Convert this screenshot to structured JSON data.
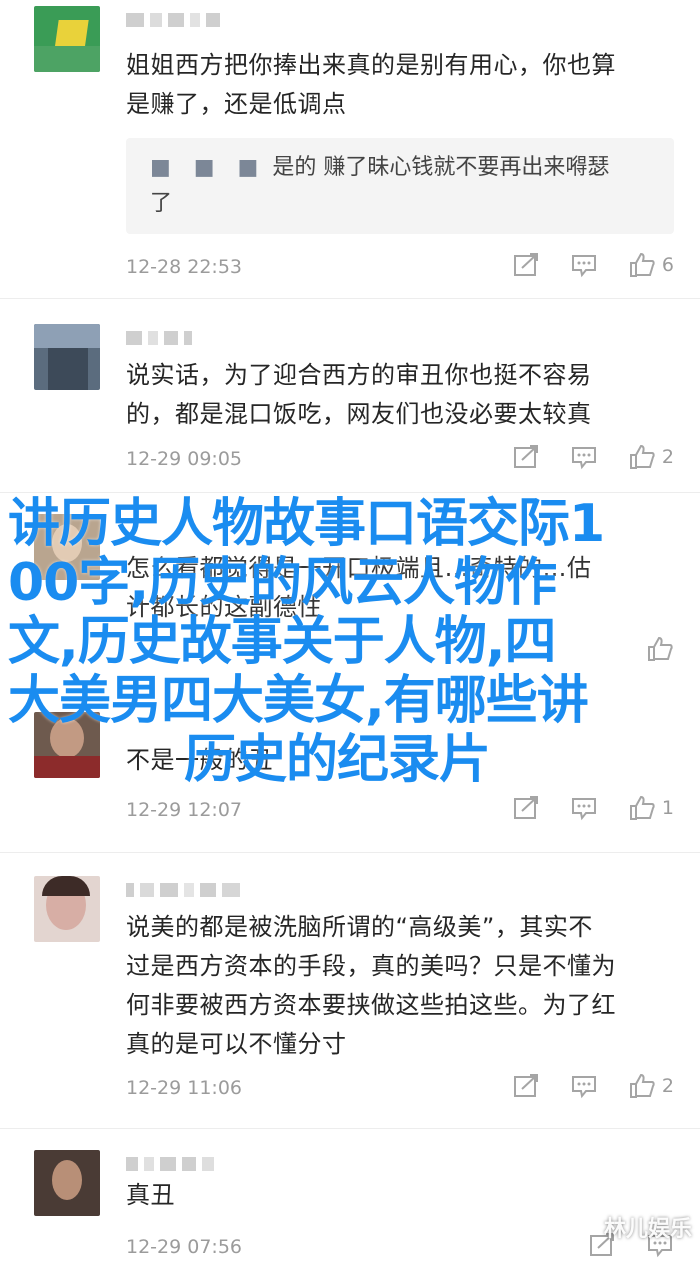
{
  "comments": [
    {
      "text_lines": [
        "姐姐西方把你捧出来真的是别有用心，你也算",
        "是赚了，还是低调点"
      ],
      "quote": {
        "dots": "■ ■ ■",
        "lines": [
          "是的 赚了昧心钱就不要再出来嘚瑟",
          "了"
        ]
      },
      "time": "12-28 22:53",
      "likes": "6"
    },
    {
      "text_lines": [
        "说实话，为了迎合西方的审丑你也挺不容易",
        "的，都是混口饭吃，网友们也没必要太较真"
      ],
      "time": "12-29 09:05",
      "likes": "2"
    },
    {
      "text_lines": [
        "怎么看都觉得是一开口极端且…奇特的…估",
        "计都长的这副德性"
      ],
      "time": "",
      "likes": ""
    },
    {
      "text_lines": [
        "不是一般的丑"
      ],
      "time": "12-29 12:07",
      "likes": "1"
    },
    {
      "text_lines": [
        "说美的都是被洗脑所谓的“高级美”，其实不",
        "过是西方资本的手段，真的美吗？只是不懂为",
        "何非要被西方资本要挟做这些拍这些。为了红",
        "真的是可以不懂分寸"
      ],
      "time": "12-29 11:06",
      "likes": "2"
    },
    {
      "text_lines": [
        "真丑"
      ],
      "time": "12-29 07:56",
      "likes": ""
    }
  ],
  "overlay_lines": [
    "讲历史人物故事口语交际1",
    "00字,历史的风云人物作",
    "文,历史故事关于人物,四",
    "大美男四大美女,有哪些讲",
    "历史的纪录片"
  ],
  "watermark": "林儿娱乐",
  "colors": {
    "overlay": "#1a8cf0",
    "meta": "#9b9b9b"
  }
}
